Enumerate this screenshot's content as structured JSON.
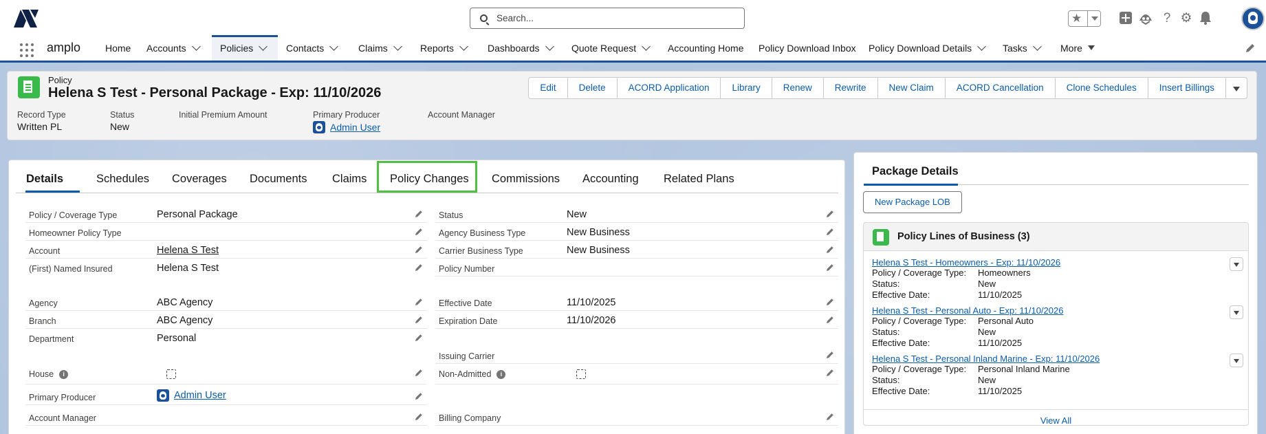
{
  "global_header": {
    "search_placeholder": "Search..."
  },
  "nav": {
    "app_name": "amplo",
    "items": [
      {
        "label": "Home",
        "dropdown": false
      },
      {
        "label": "Accounts",
        "dropdown": true
      },
      {
        "label": "Policies",
        "dropdown": true,
        "active": true
      },
      {
        "label": "Contacts",
        "dropdown": true
      },
      {
        "label": "Claims",
        "dropdown": true
      },
      {
        "label": "Reports",
        "dropdown": true
      },
      {
        "label": "Dashboards",
        "dropdown": true
      },
      {
        "label": "Quote Request",
        "dropdown": true
      },
      {
        "label": "Accounting Home",
        "dropdown": false
      },
      {
        "label": "Policy Download Inbox",
        "dropdown": false
      },
      {
        "label": "Policy Download Details",
        "dropdown": true
      },
      {
        "label": "Tasks",
        "dropdown": true
      },
      {
        "label": "More",
        "dropdown": true
      }
    ]
  },
  "record": {
    "entity_type": "Policy",
    "title": "Helena S Test - Personal Package - Exp: 11/10/2026",
    "actions": [
      "Edit",
      "Delete",
      "ACORD Application",
      "Library",
      "Renew",
      "Rewrite",
      "New Claim",
      "ACORD Cancellation",
      "Clone Schedules",
      "Insert Billings"
    ],
    "highlights": [
      {
        "label": "Record Type",
        "value": "Written PL"
      },
      {
        "label": "Status",
        "value": "New"
      },
      {
        "label": "Initial Premium Amount",
        "value": ""
      },
      {
        "label": "Primary Producer",
        "value": "Admin User"
      },
      {
        "label": "Account Manager",
        "value": ""
      }
    ]
  },
  "tabs": [
    "Details",
    "Schedules",
    "Coverages",
    "Documents",
    "Claims",
    "Policy Changes",
    "Commissions",
    "Accounting",
    "Related Plans"
  ],
  "details": {
    "left": [
      {
        "label": "Policy / Coverage Type",
        "value": "Personal Package"
      },
      {
        "label": "Homeowner Policy Type",
        "value": ""
      },
      {
        "label": "Account",
        "value": "Helena S Test"
      },
      {
        "label": "(First) Named Insured",
        "value": "Helena S Test"
      },
      {
        "label": "Agency",
        "value": "ABC Agency"
      },
      {
        "label": "Branch",
        "value": "ABC Agency"
      },
      {
        "label": "Department",
        "value": "Personal"
      },
      {
        "label": "House",
        "value": ""
      },
      {
        "label": "Primary Producer",
        "value": "Admin User"
      },
      {
        "label": "Account Manager",
        "value": ""
      }
    ],
    "right": [
      {
        "label": "Status",
        "value": "New"
      },
      {
        "label": "Agency Business Type",
        "value": "New Business"
      },
      {
        "label": "Carrier Business Type",
        "value": "New Business"
      },
      {
        "label": "Policy Number",
        "value": ""
      },
      {
        "label": "Effective Date",
        "value": "11/10/2025"
      },
      {
        "label": "Expiration Date",
        "value": "11/10/2026"
      },
      {
        "label": "Issuing Carrier",
        "value": ""
      },
      {
        "label": "Non-Admitted",
        "value": ""
      },
      {
        "label": "Billing Company",
        "value": ""
      }
    ]
  },
  "side": {
    "tab": "Package Details",
    "new_button": "New Package LOB",
    "list_title": "Policy Lines of Business (3)",
    "items": [
      {
        "link": "Helena S Test - Homeowners - Exp: 11/10/2026",
        "fields": [
          [
            "Policy / Coverage Type:",
            "Homeowners"
          ],
          [
            "Status:",
            "New"
          ],
          [
            "Effective Date:",
            "11/10/2025"
          ]
        ]
      },
      {
        "link": "Helena S Test - Personal Auto - Exp: 11/10/2026",
        "fields": [
          [
            "Policy / Coverage Type:",
            "Personal Auto"
          ],
          [
            "Status:",
            "New"
          ],
          [
            "Effective Date:",
            "11/10/2025"
          ]
        ]
      },
      {
        "link": "Helena S Test - Personal Inland Marine - Exp: 11/10/2026",
        "fields": [
          [
            "Policy / Coverage Type:",
            "Personal Inland Marine"
          ],
          [
            "Status:",
            "New"
          ],
          [
            "Effective Date:",
            "11/10/2025"
          ]
        ]
      }
    ],
    "view_all": "View All"
  }
}
